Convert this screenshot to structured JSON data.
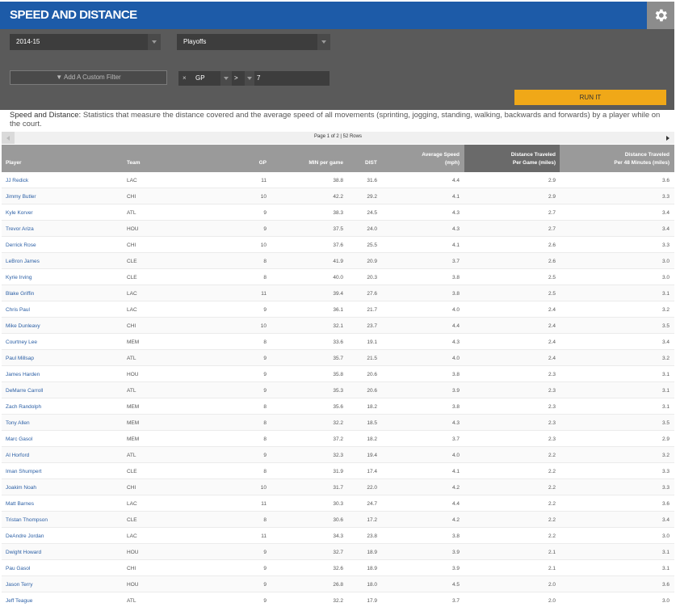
{
  "header": {
    "title": "SPEED AND DISTANCE",
    "gear_icon": "gear-icon"
  },
  "filters": {
    "season": "2014-15",
    "season_type": "Playoffs",
    "add_filter_label": "Add A Custom Filter",
    "custom_filter": {
      "remove": "×",
      "stat": "GP",
      "operator": ">",
      "value": "7"
    },
    "run_label": "RUN IT"
  },
  "description": {
    "label": "Speed and Distance:",
    "text": "Statistics that measure the distance covered and the average speed of all movements (sprinting, jogging, standing, walking, backwards and forwards) by a player while on the court."
  },
  "pager": {
    "text": "Page 1 of 2 | 52 Rows"
  },
  "colors": {
    "header_bg": "#1d5ba8",
    "filter_bg": "#5a5a5a",
    "run_button": "#f0a818",
    "sorted_column": "#6a6a6a"
  },
  "table": {
    "columns": {
      "player": "Player",
      "team": "Team",
      "gp": "GP",
      "min": "MIN per game",
      "dist": "DIST",
      "speed_1": "Average Speed",
      "speed_2": "(mph)",
      "dpg_1": "Distance Traveled",
      "dpg_2": "Per Game (miles)",
      "d48_1": "Distance Traveled",
      "d48_2": "Per 48 Minutes (miles)"
    },
    "rows": [
      [
        "JJ Redick",
        "LAC",
        "11",
        "38.8",
        "31.6",
        "4.4",
        "2.9",
        "3.6"
      ],
      [
        "Jimmy Butler",
        "CHI",
        "10",
        "42.2",
        "29.2",
        "4.1",
        "2.9",
        "3.3"
      ],
      [
        "Kyle Korver",
        "ATL",
        "9",
        "38.3",
        "24.5",
        "4.3",
        "2.7",
        "3.4"
      ],
      [
        "Trevor Ariza",
        "HOU",
        "9",
        "37.5",
        "24.0",
        "4.3",
        "2.7",
        "3.4"
      ],
      [
        "Derrick Rose",
        "CHI",
        "10",
        "37.6",
        "25.5",
        "4.1",
        "2.6",
        "3.3"
      ],
      [
        "LeBron James",
        "CLE",
        "8",
        "41.9",
        "20.9",
        "3.7",
        "2.6",
        "3.0"
      ],
      [
        "Kyrie Irving",
        "CLE",
        "8",
        "40.0",
        "20.3",
        "3.8",
        "2.5",
        "3.0"
      ],
      [
        "Blake Griffin",
        "LAC",
        "11",
        "39.4",
        "27.6",
        "3.8",
        "2.5",
        "3.1"
      ],
      [
        "Chris Paul",
        "LAC",
        "9",
        "36.1",
        "21.7",
        "4.0",
        "2.4",
        "3.2"
      ],
      [
        "Mike Dunleavy",
        "CHI",
        "10",
        "32.1",
        "23.7",
        "4.4",
        "2.4",
        "3.5"
      ],
      [
        "Courtney Lee",
        "MEM",
        "8",
        "33.6",
        "19.1",
        "4.3",
        "2.4",
        "3.4"
      ],
      [
        "Paul Millsap",
        "ATL",
        "9",
        "35.7",
        "21.5",
        "4.0",
        "2.4",
        "3.2"
      ],
      [
        "James Harden",
        "HOU",
        "9",
        "35.8",
        "20.6",
        "3.8",
        "2.3",
        "3.1"
      ],
      [
        "DeMarre Carroll",
        "ATL",
        "9",
        "35.3",
        "20.6",
        "3.9",
        "2.3",
        "3.1"
      ],
      [
        "Zach Randolph",
        "MEM",
        "8",
        "35.6",
        "18.2",
        "3.8",
        "2.3",
        "3.1"
      ],
      [
        "Tony Allen",
        "MEM",
        "8",
        "32.2",
        "18.5",
        "4.3",
        "2.3",
        "3.5"
      ],
      [
        "Marc Gasol",
        "MEM",
        "8",
        "37.2",
        "18.2",
        "3.7",
        "2.3",
        "2.9"
      ],
      [
        "Al Horford",
        "ATL",
        "9",
        "32.3",
        "19.4",
        "4.0",
        "2.2",
        "3.2"
      ],
      [
        "Iman Shumpert",
        "CLE",
        "8",
        "31.9",
        "17.4",
        "4.1",
        "2.2",
        "3.3"
      ],
      [
        "Joakim Noah",
        "CHI",
        "10",
        "31.7",
        "22.0",
        "4.2",
        "2.2",
        "3.3"
      ],
      [
        "Matt Barnes",
        "LAC",
        "11",
        "30.3",
        "24.7",
        "4.4",
        "2.2",
        "3.6"
      ],
      [
        "Tristan Thompson",
        "CLE",
        "8",
        "30.6",
        "17.2",
        "4.2",
        "2.2",
        "3.4"
      ],
      [
        "DeAndre Jordan",
        "LAC",
        "11",
        "34.3",
        "23.8",
        "3.8",
        "2.2",
        "3.0"
      ],
      [
        "Dwight Howard",
        "HOU",
        "9",
        "32.7",
        "18.9",
        "3.9",
        "2.1",
        "3.1"
      ],
      [
        "Pau Gasol",
        "CHI",
        "9",
        "32.6",
        "18.9",
        "3.9",
        "2.1",
        "3.1"
      ],
      [
        "Jason Terry",
        "HOU",
        "9",
        "26.8",
        "18.0",
        "4.5",
        "2.0",
        "3.6"
      ],
      [
        "Jeff Teague",
        "ATL",
        "9",
        "32.2",
        "17.9",
        "3.7",
        "2.0",
        "3.0"
      ]
    ]
  }
}
